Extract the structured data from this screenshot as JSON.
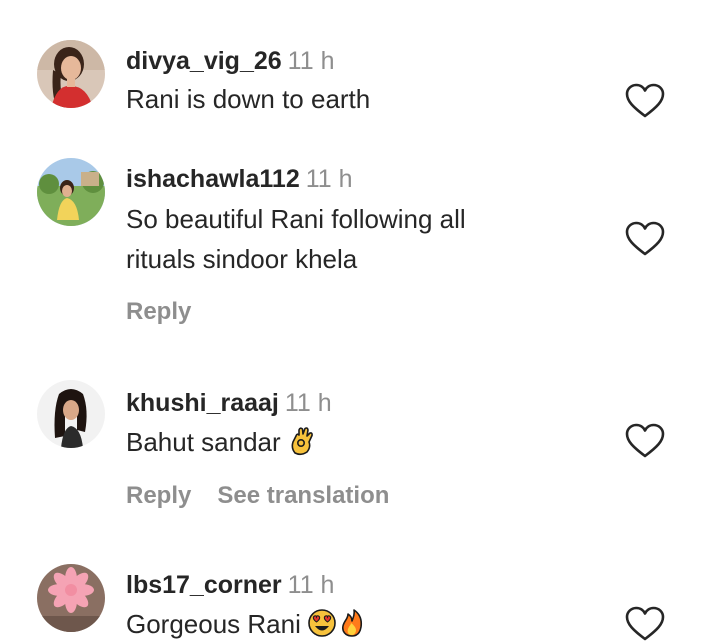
{
  "comments": [
    {
      "username": "divya_vig_26",
      "time": "11 h",
      "text_lines": [
        "Rani is down to earth"
      ],
      "reply_label": "",
      "translate_label": ""
    },
    {
      "username": "ishachawla112",
      "time": "11 h",
      "text_lines": [
        "So beautiful Rani following all",
        "rituals sindoor khela"
      ],
      "reply_label": "Reply",
      "translate_label": ""
    },
    {
      "username": "khushi_raaaj",
      "time": "11 h",
      "text_lines": [
        "Bahut sandar"
      ],
      "emojis": [
        "ok-hand-emoji"
      ],
      "reply_label": "Reply",
      "translate_label": "See translation"
    },
    {
      "username": "lbs17_corner",
      "time": "11 h",
      "text_lines": [
        "Gorgeous Rani"
      ],
      "emojis": [
        "heart-eyes-emoji",
        "fire-emoji"
      ],
      "reply_label": "",
      "translate_label": ""
    }
  ],
  "icons": {
    "like": "heart-outline-icon"
  },
  "colors": {
    "text": "#262626",
    "secondary": "#8e8e8e",
    "background": "#ffffff"
  }
}
